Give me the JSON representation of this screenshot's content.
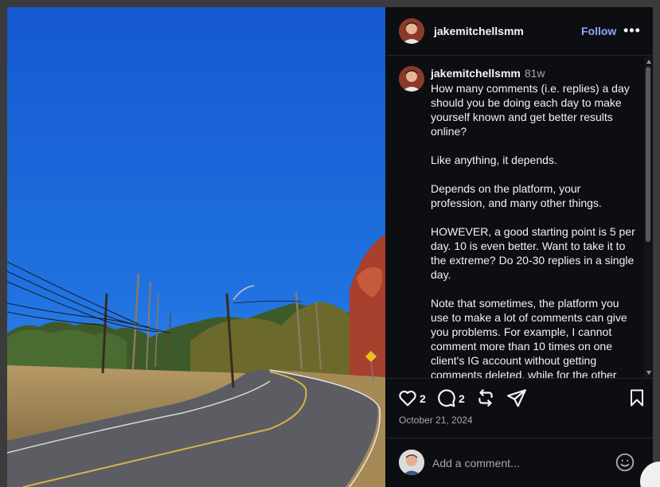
{
  "post": {
    "username": "jakemitchellsmm",
    "follow_label": "Follow",
    "more_label": "•••",
    "caption": {
      "username": "jakemitchellsmm",
      "time_ago": "81w",
      "paragraphs": [
        "How many comments (i.e. replies) a day should you be doing each day to make yourself known and get better results online?",
        "Like anything, it depends.",
        "Depends on the platform, your profession, and many other things.",
        "HOWEVER, a good starting point is 5 per day. 10 is even better. Want to take it to the extreme? Do 20-30 replies in a single day.",
        "Note that sometimes, the platform you use to make a lot of comments can give you problems. For example, I cannot comment more than 10 times on one client's IG account without getting comments deleted, while for the other"
      ]
    },
    "likes_count": "2",
    "comments_count": "2",
    "date": "October 21, 2024",
    "comment_placeholder": "Add a comment..."
  },
  "icons": {
    "like": "heart-icon",
    "comment": "comment-icon",
    "repost": "repost-icon",
    "share": "share-icon",
    "save": "bookmark-icon",
    "emoji": "emoji-icon",
    "more": "more-icon"
  },
  "colors": {
    "panel_bg": "#0d0e11",
    "follow": "#8aa7ff",
    "muted_text": "#a8a8a8",
    "sky": "#1763d8"
  }
}
